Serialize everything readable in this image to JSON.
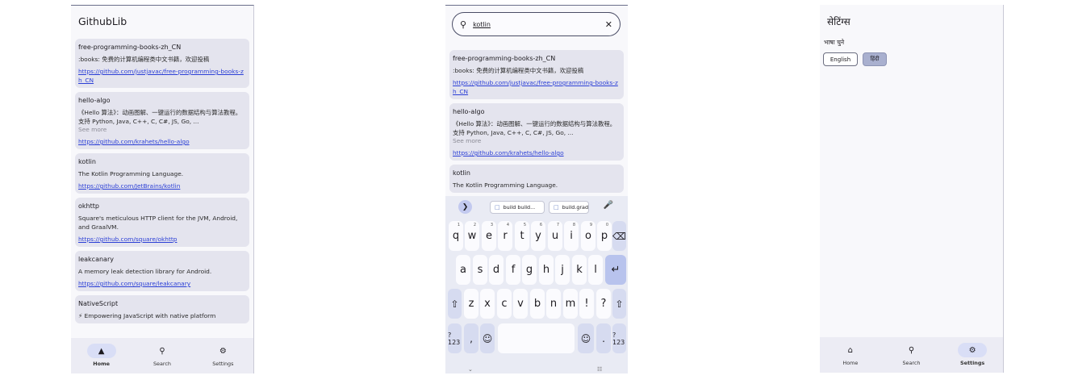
{
  "home": {
    "title": "GithubLib",
    "repos": [
      {
        "name": "free-programming-books-zh_CN",
        "description": ":books: 免费的计算机编程类中文书籍，欢迎投稿",
        "more": "",
        "link": "https://github.com/justjavac/free-programming-books-zh_CN"
      },
      {
        "name": "hello-algo",
        "description": "《Hello 算法》：动画图解、一键运行的数据结构与算法教程。支持 Python, Java, C++, C, C#, JS, Go, ...",
        "more": "See more",
        "link": "https://github.com/krahets/hello-algo"
      },
      {
        "name": "kotlin",
        "description": "The Kotlin Programming Language.",
        "more": "",
        "link": "https://github.com/JetBrains/kotlin"
      },
      {
        "name": "okhttp",
        "description": "Square's meticulous HTTP client for the JVM, Android, and GraalVM.",
        "more": "",
        "link": "https://github.com/square/okhttp"
      },
      {
        "name": "leakcanary",
        "description": "A memory leak detection library for Android.",
        "more": "",
        "link": "https://github.com/square/leakcanary"
      },
      {
        "name": "NativeScript",
        "description": "⚡ Empowering JavaScript with native platform",
        "more": "",
        "link": ""
      }
    ]
  },
  "search": {
    "query": "kotlin",
    "repos": [
      {
        "name": "free-programming-books-zh_CN",
        "description": ":books: 免费的计算机编程类中文书籍，欢迎投稿",
        "more": "",
        "link": "https://github.com/justjavac/free-programming-books-zh_CN"
      },
      {
        "name": "hello-algo",
        "description": "《Hello 算法》：动画图解、一键运行的数据结构与算法教程。支持 Python, Java, C++, C, C#, JS, Go, ...",
        "more": "See more",
        "link": "https://github.com/krahets/hello-algo"
      },
      {
        "name": "kotlin",
        "description": "The Kotlin Programming Language.",
        "more": "",
        "link": ""
      }
    ],
    "keyboard": {
      "suggestions": [
        "build build...",
        "build.grad"
      ],
      "row1": [
        "q",
        "w",
        "e",
        "r",
        "t",
        "y",
        "u",
        "i",
        "o",
        "p"
      ],
      "row1_hints": [
        "1",
        "2",
        "3",
        "4",
        "5",
        "6",
        "7",
        "8",
        "9",
        "0"
      ],
      "row2": [
        "a",
        "s",
        "d",
        "f",
        "g",
        "h",
        "j",
        "k",
        "l"
      ],
      "row3": [
        "z",
        "x",
        "c",
        "v",
        "b",
        "n",
        "m",
        "!",
        "?"
      ],
      "symbols": "?123",
      "comma": ",",
      "period": "."
    }
  },
  "settings": {
    "title": "सेटिंग्स",
    "language_label": "भाषा चुने",
    "options": [
      "English",
      "हिंदी"
    ]
  },
  "nav": {
    "home": "Home",
    "search": "Search",
    "settings": "Settings"
  },
  "colors": {
    "accent": "#d9def6",
    "link": "#2b3fd6",
    "card": "#e4e4ee"
  }
}
